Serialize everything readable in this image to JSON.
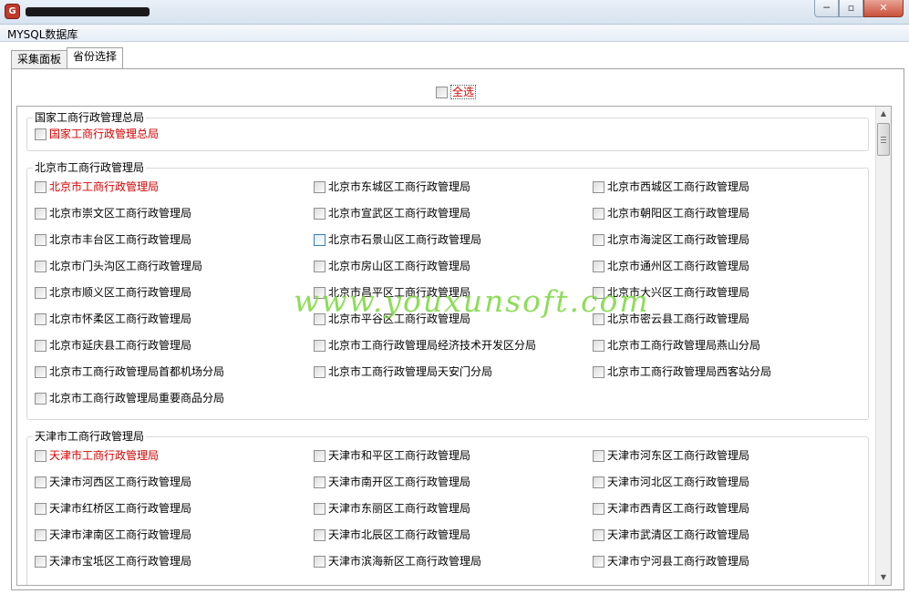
{
  "window": {
    "icon": "app-logo-icon",
    "controls": {
      "minimize": "─",
      "maximize": "▫",
      "close": "✕"
    }
  },
  "menu": {
    "item": "MYSQL数据库"
  },
  "tabs": [
    "采集面板",
    "省份选择"
  ],
  "select_all": {
    "label": "全选"
  },
  "groups": [
    {
      "title": "国家工商行政管理总局",
      "items": [
        {
          "label": "国家工商行政管理总局",
          "red": true
        }
      ]
    },
    {
      "title": "北京市工商行政管理局",
      "items": [
        {
          "label": "北京市工商行政管理局",
          "red": true
        },
        {
          "label": "北京市东城区工商行政管理局"
        },
        {
          "label": "北京市西城区工商行政管理局"
        },
        {
          "label": "北京市崇文区工商行政管理局"
        },
        {
          "label": "北京市宣武区工商行政管理局"
        },
        {
          "label": "北京市朝阳区工商行政管理局"
        },
        {
          "label": "北京市丰台区工商行政管理局"
        },
        {
          "label": "北京市石景山区工商行政管理局",
          "hover": true
        },
        {
          "label": "北京市海淀区工商行政管理局"
        },
        {
          "label": "北京市门头沟区工商行政管理局"
        },
        {
          "label": "北京市房山区工商行政管理局"
        },
        {
          "label": "北京市通州区工商行政管理局"
        },
        {
          "label": "北京市顺义区工商行政管理局"
        },
        {
          "label": "北京市昌平区工商行政管理局"
        },
        {
          "label": "北京市大兴区工商行政管理局"
        },
        {
          "label": "北京市怀柔区工商行政管理局"
        },
        {
          "label": "北京市平谷区工商行政管理局"
        },
        {
          "label": "北京市密云县工商行政管理局"
        },
        {
          "label": "北京市延庆县工商行政管理局"
        },
        {
          "label": "北京市工商行政管理局经济技术开发区分局"
        },
        {
          "label": "北京市工商行政管理局燕山分局"
        },
        {
          "label": "北京市工商行政管理局首都机场分局"
        },
        {
          "label": "北京市工商行政管理局天安门分局"
        },
        {
          "label": "北京市工商行政管理局西客站分局"
        },
        {
          "label": "北京市工商行政管理局重要商品分局"
        }
      ]
    },
    {
      "title": "天津市工商行政管理局",
      "items": [
        {
          "label": "天津市工商行政管理局",
          "red": true
        },
        {
          "label": "天津市和平区工商行政管理局"
        },
        {
          "label": "天津市河东区工商行政管理局"
        },
        {
          "label": "天津市河西区工商行政管理局"
        },
        {
          "label": "天津市南开区工商行政管理局"
        },
        {
          "label": "天津市河北区工商行政管理局"
        },
        {
          "label": "天津市红桥区工商行政管理局"
        },
        {
          "label": "天津市东丽区工商行政管理局"
        },
        {
          "label": "天津市西青区工商行政管理局"
        },
        {
          "label": "天津市津南区工商行政管理局"
        },
        {
          "label": "天津市北辰区工商行政管理局"
        },
        {
          "label": "天津市武清区工商行政管理局"
        },
        {
          "label": "天津市宝坻区工商行政管理局"
        },
        {
          "label": "天津市滨海新区工商行政管理局"
        },
        {
          "label": "天津市宁河县工商行政管理局"
        }
      ]
    }
  ],
  "watermark": "www.youxunsoft.com",
  "scrollbar": {
    "up": "▲",
    "down": "▼"
  }
}
